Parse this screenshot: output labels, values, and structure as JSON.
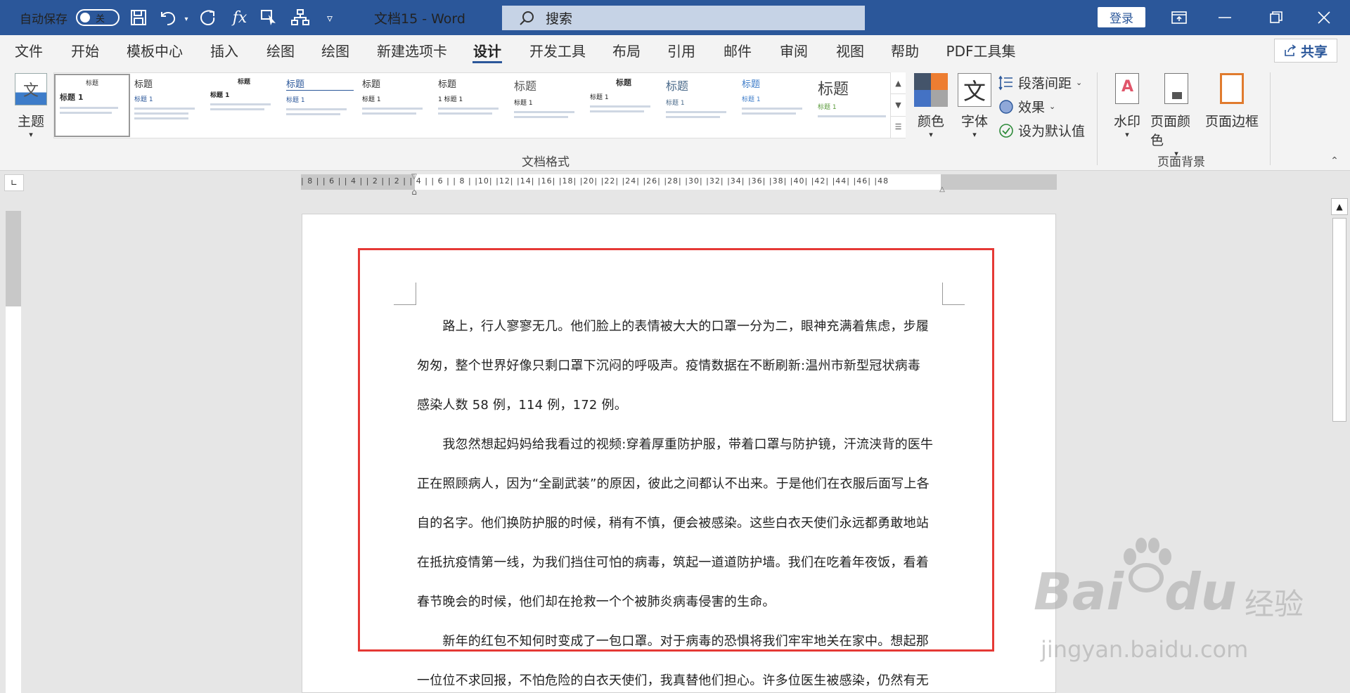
{
  "titlebar": {
    "autosave_label": "自动保存",
    "autosave_state": "关",
    "doc_title": "文档15  -  Word",
    "search_placeholder": "搜索",
    "login_label": "登录",
    "accent_color": "#2b579a"
  },
  "quick_access": [
    "save-icon",
    "undo-icon",
    "redo-icon",
    "function-icon",
    "pointer-icon",
    "org-chart-icon",
    "customize-icon"
  ],
  "tabs": [
    "文件",
    "开始",
    "模板中心",
    "插入",
    "绘图",
    "绘图",
    "新建选项卡",
    "设计",
    "开发工具",
    "布局",
    "引用",
    "邮件",
    "审阅",
    "视图",
    "帮助",
    "PDF工具集"
  ],
  "active_tab": "设计",
  "share_label": "共享",
  "ribbon": {
    "theme_label": "主题",
    "gallery": [
      {
        "title": "标题",
        "heading": "标题 1"
      },
      {
        "title": "标题",
        "heading": "标题 1"
      },
      {
        "title": "标题",
        "heading": "标题 1"
      },
      {
        "title": "标题",
        "heading": "标题 1"
      },
      {
        "title": "标题",
        "heading": "标题 1"
      },
      {
        "title": "标题",
        "heading": "1 标题 1"
      },
      {
        "title": "标题",
        "heading": "标题 1"
      },
      {
        "title": "标题",
        "heading": "标题 1"
      },
      {
        "title": "标题",
        "heading": "标题 1"
      },
      {
        "title": "标题",
        "heading": "标题 1"
      },
      {
        "title": "标题",
        "heading": "标题 1"
      }
    ],
    "colors_label": "颜色",
    "fonts_label": "字体",
    "paragraph_spacing_label": "段落间距",
    "effects_label": "效果",
    "set_default_label": "设为默认值",
    "group_doc_format": "文档格式",
    "watermark_label": "水印",
    "page_color_label": "页面颜色",
    "page_border_label": "页面边框",
    "group_page_bg": "页面背景",
    "font_glyph": "文"
  },
  "ruler": {
    "numbers": "| 8 |  | 6 |  | 4 |  | 2 |     | 2 |  | 4 |  | 6 |  | 8 |  |10|  |12|  |14|  |16|  |18|  |20|  |22|  |24|  |26|  |28|  |30|  |32|  |34|  |36|  |38|  |40|  |42|  |44|  |46|  |48"
  },
  "document": {
    "lines": [
      "　　路上，行人寥寥无几。他们脸上的表情被大大的口罩一分为二，眼神充满着焦虑，步履",
      "匆匆，整个世界好像只剩口罩下沉闷的呼吸声。疫情数据在不断刷新:温州市新型冠状病毒",
      "感染人数 58 例，114 例，172 例。",
      "　　我忽然想起妈妈给我看过的视频:穿着厚重防护服，带着口罩与防护镜，汗流浃背的医牛",
      "正在照顾病人，因为“全副武装”的原因，彼此之间都认不出来。于是他们在衣服后面写上各",
      "自的名字。他们换防护服的时候，稍有不慎，便会被感染。这些白衣天使们永远都勇敢地站",
      "在抵抗疫情第一线，为我们挡住可怕的病毒，筑起一道道防护墙。我们在吃着年夜饭，看着",
      "春节晚会的时候，他们却在抢救一个个被肺炎病毒侵害的生命。",
      "　　新年的红包不知何时变成了一包口罩。对于病毒的恐惧将我们牢牢地关在家中。想起那",
      "一位位不求回报，不怕危险的白衣天使们，我真替他们担心。许多位医生被感染，仍然有无"
    ]
  },
  "watermark": {
    "brand": "Bai",
    "brand2": "du",
    "jingyan": "经验",
    "url": "jingyan.baidu.com"
  }
}
